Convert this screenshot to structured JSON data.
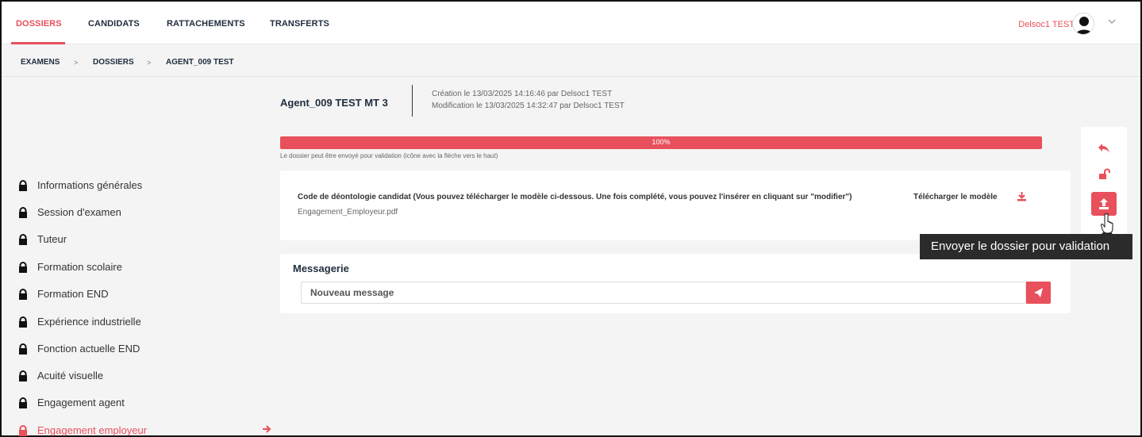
{
  "nav": {
    "tabs": [
      "DOSSIERS",
      "CANDIDATS",
      "RATTACHEMENTS",
      "TRANSFERTS"
    ],
    "active_tab": "DOSSIERS",
    "user_name": "Delsoc1 TEST"
  },
  "breadcrumb": {
    "items": [
      "EXAMENS",
      "DOSSIERS",
      "AGENT_009 TEST"
    ],
    "separator": ">"
  },
  "sidebar": {
    "items": [
      "Informations générales",
      "Session d'examen",
      "Tuteur",
      "Formation scolaire",
      "Formation END",
      "Expérience industrielle",
      "Fonction actuelle END",
      "Acuité visuelle",
      "Engagement agent",
      "Engagement employeur"
    ],
    "active_item": "Engagement employeur"
  },
  "record": {
    "title": "Agent_009 TEST MT 3",
    "created": "Création le 13/03/2025 14:16:46 par Delsoc1 TEST",
    "modified": "Modification le 13/03/2025 14:32:47 par Delsoc1 TEST"
  },
  "progress": {
    "value": 100,
    "label": "100%",
    "note": "Le dossier peut être envoyé pour validation (icône avec la flèche vers le haut)"
  },
  "document": {
    "label": "Code de déontologie candidat (Vous pouvez télécharger le modèle ci-dessous. Une fois complété, vous pouvez l'insérer en cliquant sur \"modifier\")",
    "download_label": "Télécharger le modèle",
    "file_name": "Engagement_Employeur.pdf"
  },
  "messagerie": {
    "title": "Messagerie",
    "placeholder": "Nouveau message"
  },
  "tooltip": {
    "text": "Envoyer le dossier pour validation"
  },
  "icons": {
    "back": "reply-arrow-icon",
    "unlock": "unlock-icon",
    "upload": "upload-icon",
    "send": "paper-plane-icon",
    "download": "download-icon",
    "lock": "lock-icon",
    "arrow": "arrow-right-icon",
    "avatar": "user-avatar-icon",
    "chevron": "chevron-down-icon",
    "cursor": "hand-pointer-icon"
  },
  "colors": {
    "accent": "#e8505b",
    "text_dark": "#1f2d3d",
    "tooltip_bg": "#2b2b2b"
  }
}
